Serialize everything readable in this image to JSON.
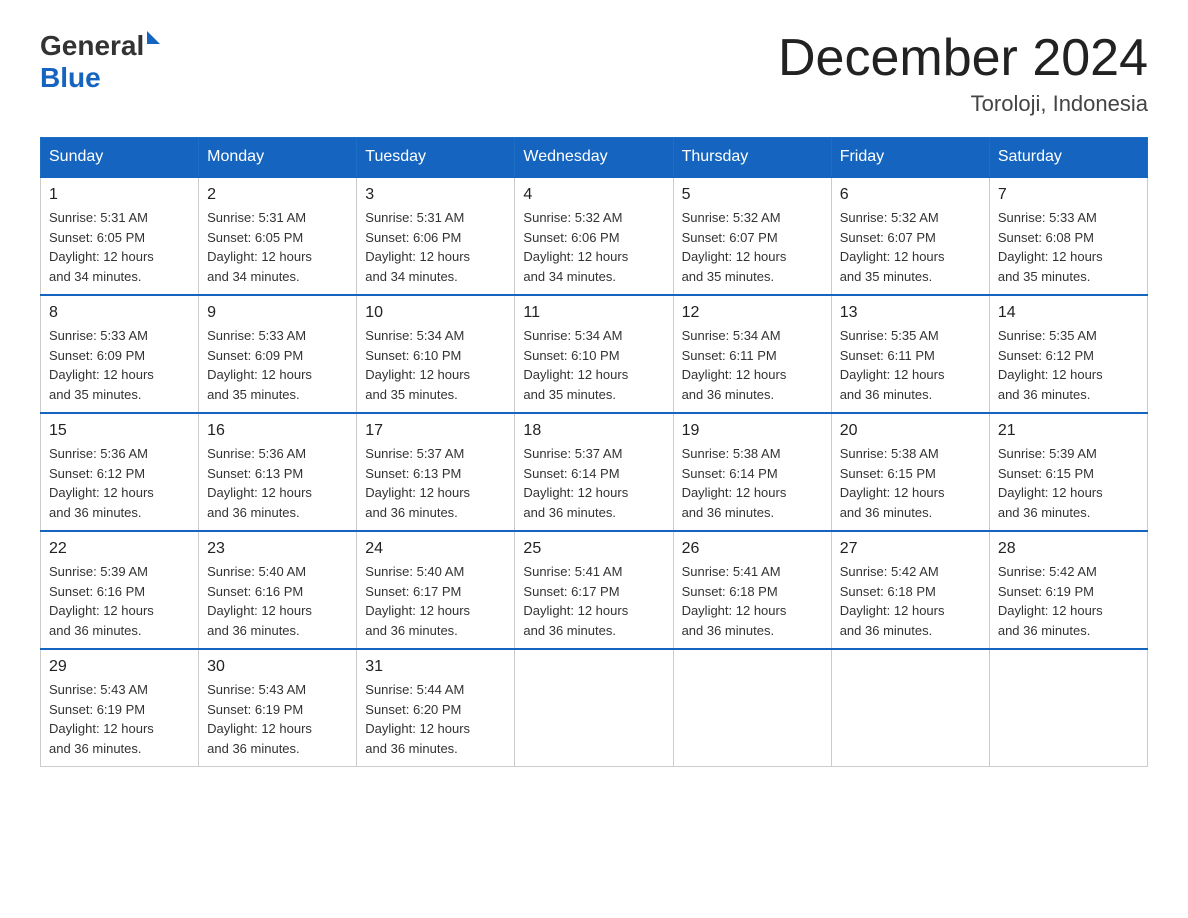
{
  "header": {
    "logo_general": "General",
    "logo_blue": "Blue",
    "month_title": "December 2024",
    "location": "Toroloji, Indonesia"
  },
  "weekdays": [
    "Sunday",
    "Monday",
    "Tuesday",
    "Wednesday",
    "Thursday",
    "Friday",
    "Saturday"
  ],
  "weeks": [
    [
      {
        "day": "1",
        "info": "Sunrise: 5:31 AM\nSunset: 6:05 PM\nDaylight: 12 hours\nand 34 minutes."
      },
      {
        "day": "2",
        "info": "Sunrise: 5:31 AM\nSunset: 6:05 PM\nDaylight: 12 hours\nand 34 minutes."
      },
      {
        "day": "3",
        "info": "Sunrise: 5:31 AM\nSunset: 6:06 PM\nDaylight: 12 hours\nand 34 minutes."
      },
      {
        "day": "4",
        "info": "Sunrise: 5:32 AM\nSunset: 6:06 PM\nDaylight: 12 hours\nand 34 minutes."
      },
      {
        "day": "5",
        "info": "Sunrise: 5:32 AM\nSunset: 6:07 PM\nDaylight: 12 hours\nand 35 minutes."
      },
      {
        "day": "6",
        "info": "Sunrise: 5:32 AM\nSunset: 6:07 PM\nDaylight: 12 hours\nand 35 minutes."
      },
      {
        "day": "7",
        "info": "Sunrise: 5:33 AM\nSunset: 6:08 PM\nDaylight: 12 hours\nand 35 minutes."
      }
    ],
    [
      {
        "day": "8",
        "info": "Sunrise: 5:33 AM\nSunset: 6:09 PM\nDaylight: 12 hours\nand 35 minutes."
      },
      {
        "day": "9",
        "info": "Sunrise: 5:33 AM\nSunset: 6:09 PM\nDaylight: 12 hours\nand 35 minutes."
      },
      {
        "day": "10",
        "info": "Sunrise: 5:34 AM\nSunset: 6:10 PM\nDaylight: 12 hours\nand 35 minutes."
      },
      {
        "day": "11",
        "info": "Sunrise: 5:34 AM\nSunset: 6:10 PM\nDaylight: 12 hours\nand 35 minutes."
      },
      {
        "day": "12",
        "info": "Sunrise: 5:34 AM\nSunset: 6:11 PM\nDaylight: 12 hours\nand 36 minutes."
      },
      {
        "day": "13",
        "info": "Sunrise: 5:35 AM\nSunset: 6:11 PM\nDaylight: 12 hours\nand 36 minutes."
      },
      {
        "day": "14",
        "info": "Sunrise: 5:35 AM\nSunset: 6:12 PM\nDaylight: 12 hours\nand 36 minutes."
      }
    ],
    [
      {
        "day": "15",
        "info": "Sunrise: 5:36 AM\nSunset: 6:12 PM\nDaylight: 12 hours\nand 36 minutes."
      },
      {
        "day": "16",
        "info": "Sunrise: 5:36 AM\nSunset: 6:13 PM\nDaylight: 12 hours\nand 36 minutes."
      },
      {
        "day": "17",
        "info": "Sunrise: 5:37 AM\nSunset: 6:13 PM\nDaylight: 12 hours\nand 36 minutes."
      },
      {
        "day": "18",
        "info": "Sunrise: 5:37 AM\nSunset: 6:14 PM\nDaylight: 12 hours\nand 36 minutes."
      },
      {
        "day": "19",
        "info": "Sunrise: 5:38 AM\nSunset: 6:14 PM\nDaylight: 12 hours\nand 36 minutes."
      },
      {
        "day": "20",
        "info": "Sunrise: 5:38 AM\nSunset: 6:15 PM\nDaylight: 12 hours\nand 36 minutes."
      },
      {
        "day": "21",
        "info": "Sunrise: 5:39 AM\nSunset: 6:15 PM\nDaylight: 12 hours\nand 36 minutes."
      }
    ],
    [
      {
        "day": "22",
        "info": "Sunrise: 5:39 AM\nSunset: 6:16 PM\nDaylight: 12 hours\nand 36 minutes."
      },
      {
        "day": "23",
        "info": "Sunrise: 5:40 AM\nSunset: 6:16 PM\nDaylight: 12 hours\nand 36 minutes."
      },
      {
        "day": "24",
        "info": "Sunrise: 5:40 AM\nSunset: 6:17 PM\nDaylight: 12 hours\nand 36 minutes."
      },
      {
        "day": "25",
        "info": "Sunrise: 5:41 AM\nSunset: 6:17 PM\nDaylight: 12 hours\nand 36 minutes."
      },
      {
        "day": "26",
        "info": "Sunrise: 5:41 AM\nSunset: 6:18 PM\nDaylight: 12 hours\nand 36 minutes."
      },
      {
        "day": "27",
        "info": "Sunrise: 5:42 AM\nSunset: 6:18 PM\nDaylight: 12 hours\nand 36 minutes."
      },
      {
        "day": "28",
        "info": "Sunrise: 5:42 AM\nSunset: 6:19 PM\nDaylight: 12 hours\nand 36 minutes."
      }
    ],
    [
      {
        "day": "29",
        "info": "Sunrise: 5:43 AM\nSunset: 6:19 PM\nDaylight: 12 hours\nand 36 minutes."
      },
      {
        "day": "30",
        "info": "Sunrise: 5:43 AM\nSunset: 6:19 PM\nDaylight: 12 hours\nand 36 minutes."
      },
      {
        "day": "31",
        "info": "Sunrise: 5:44 AM\nSunset: 6:20 PM\nDaylight: 12 hours\nand 36 minutes."
      },
      {
        "day": "",
        "info": ""
      },
      {
        "day": "",
        "info": ""
      },
      {
        "day": "",
        "info": ""
      },
      {
        "day": "",
        "info": ""
      }
    ]
  ]
}
